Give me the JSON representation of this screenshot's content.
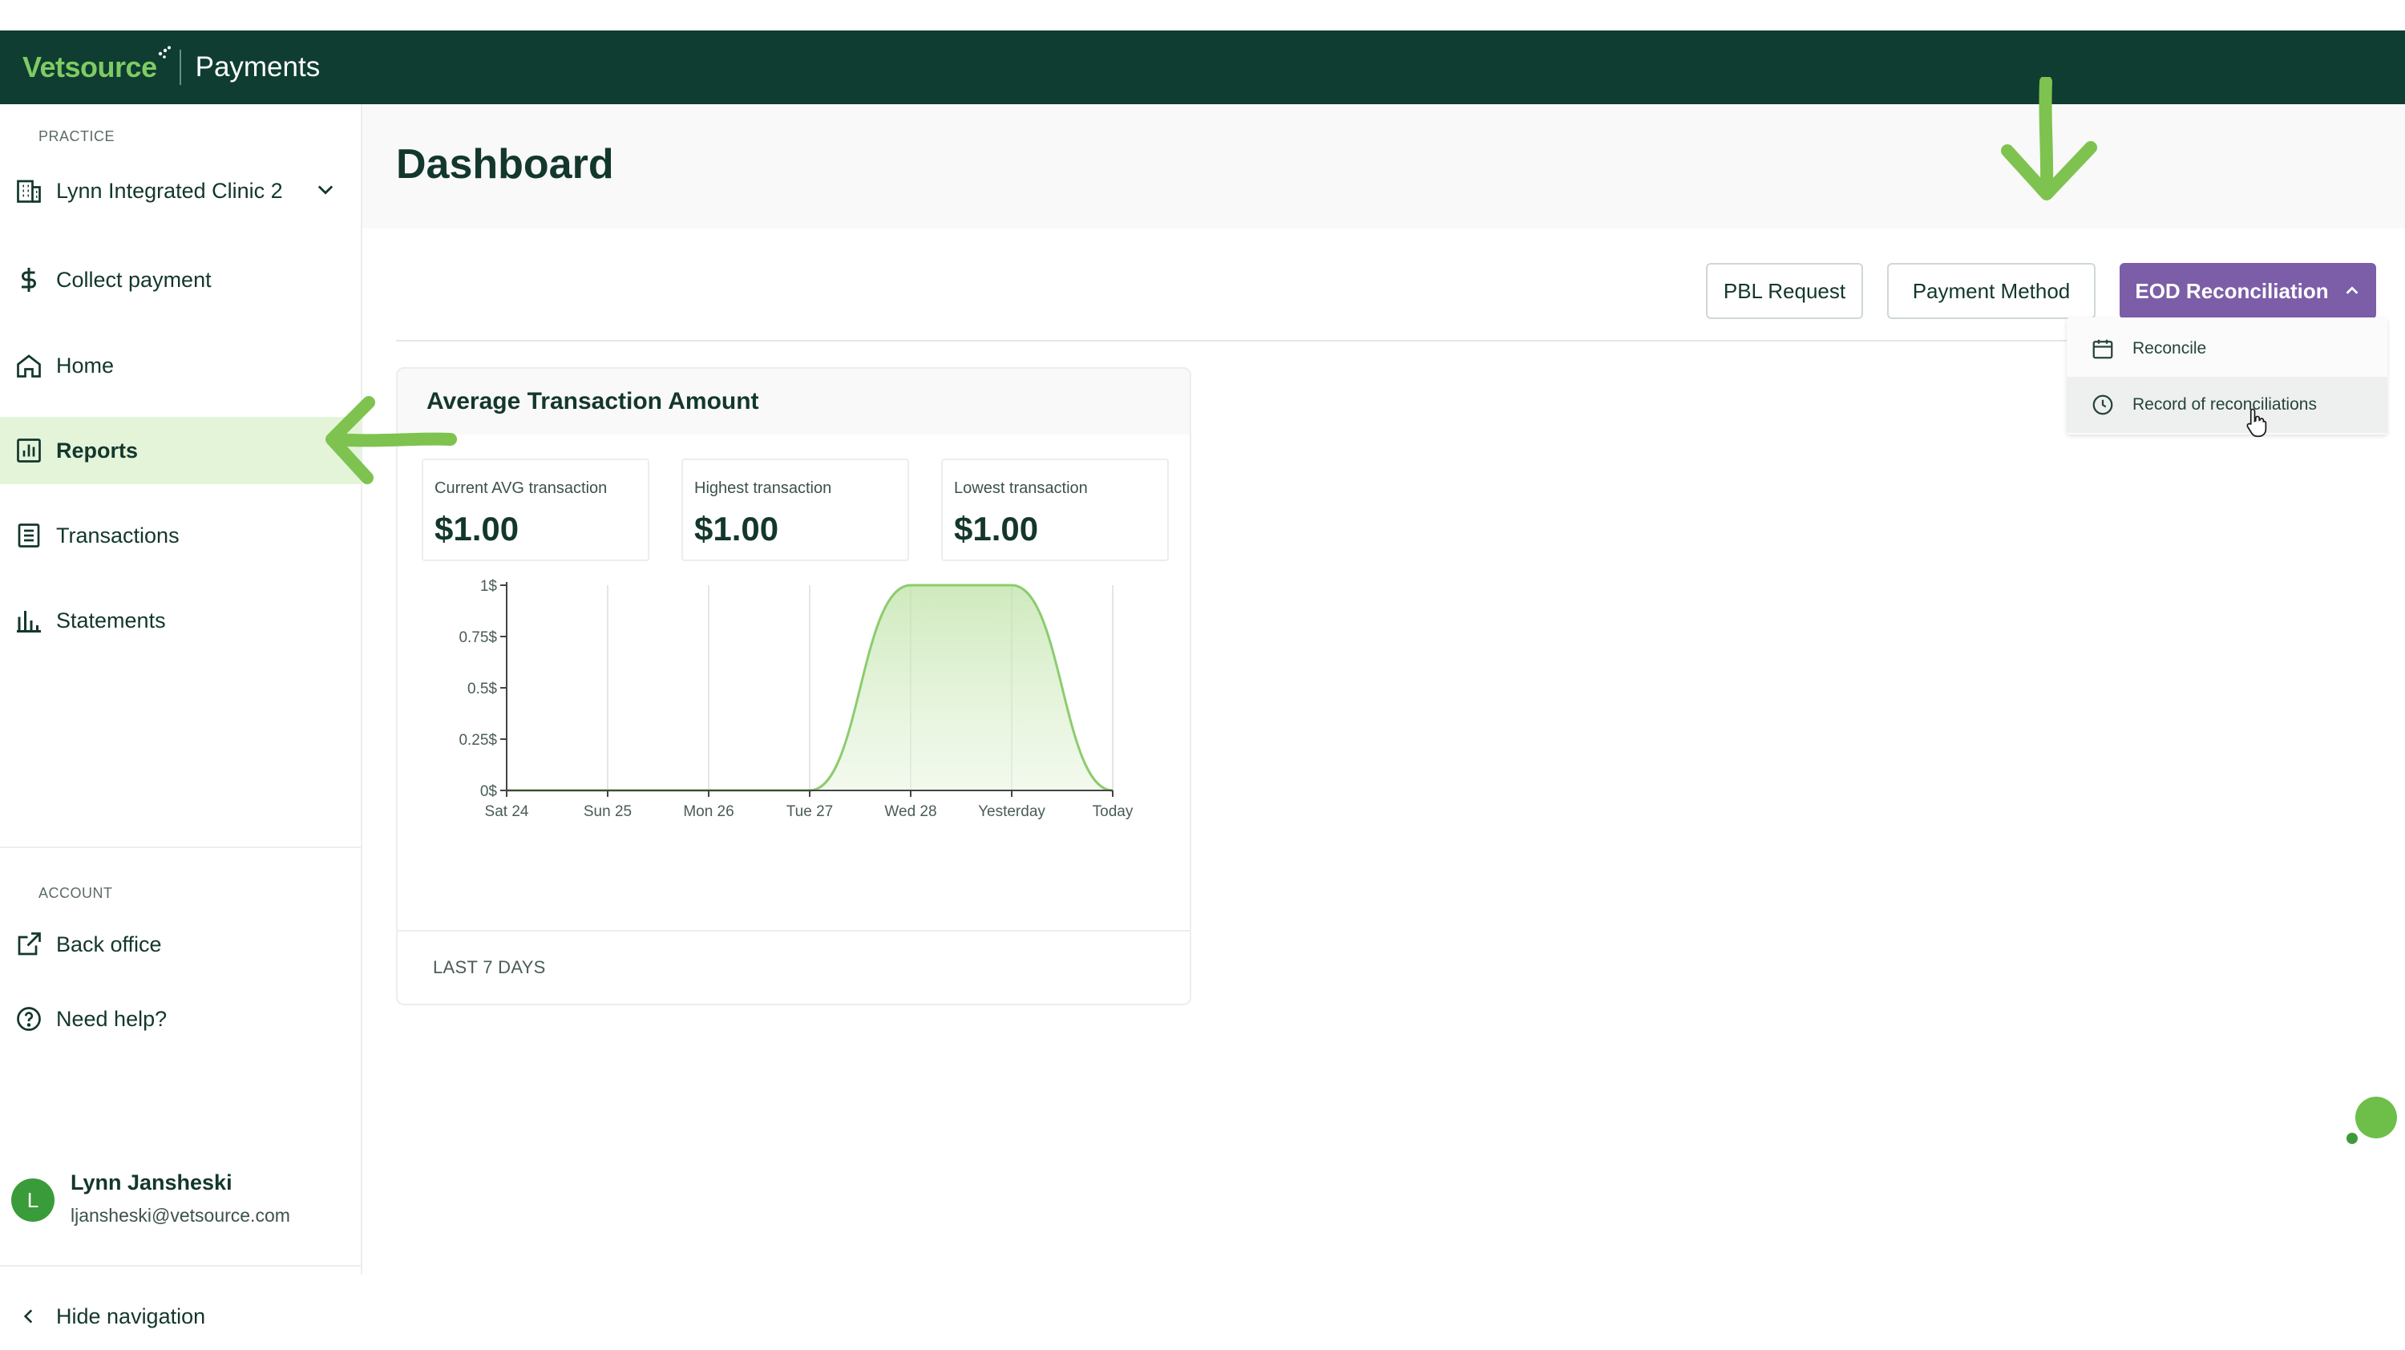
{
  "topbar": {
    "brand": "Vetsource",
    "product": "Payments"
  },
  "sidebar": {
    "practice_label": "PRACTICE",
    "practice_name": "Lynn Integrated Clinic 2",
    "items": [
      {
        "label": "Collect payment",
        "icon": "dollar-icon"
      },
      {
        "label": "Home",
        "icon": "home-icon"
      },
      {
        "label": "Reports",
        "icon": "bar-chart-icon",
        "active": true
      },
      {
        "label": "Transactions",
        "icon": "receipt-icon"
      },
      {
        "label": "Statements",
        "icon": "statements-icon"
      }
    ],
    "account_label": "ACCOUNT",
    "account_items": [
      {
        "label": "Back office",
        "icon": "external-link-icon"
      },
      {
        "label": "Need help?",
        "icon": "help-icon"
      }
    ],
    "user": {
      "initial": "L",
      "name": "Lynn Jansheski",
      "email": "ljansheski@vetsource.com"
    },
    "hide_nav": "Hide navigation"
  },
  "main": {
    "title": "Dashboard",
    "buttons": {
      "pbl_request": "PBL Request",
      "payment_method": "Payment Method",
      "eod_reconciliation": "EOD Reconciliation"
    },
    "dropdown": {
      "items": [
        {
          "label": "Reconcile",
          "icon": "calendar-icon"
        },
        {
          "label": "Record of reconciliations",
          "icon": "clock-icon"
        }
      ]
    }
  },
  "card": {
    "title": "Average Transaction Amount",
    "stats": [
      {
        "label": "Current AVG transaction",
        "value": "$1.00"
      },
      {
        "label": "Highest transaction",
        "value": "$1.00"
      },
      {
        "label": "Lowest transaction",
        "value": "$1.00"
      }
    ],
    "footer": "LAST 7 DAYS"
  },
  "colors": {
    "topbar": "#0f3d31",
    "accent_green": "#7ecb63",
    "active_nav": "#e4f4d9",
    "primary_button": "#7b5ea7"
  },
  "chart_data": {
    "type": "area",
    "categories": [
      "Sat 24",
      "Sun 25",
      "Mon 26",
      "Tue 27",
      "Wed 28",
      "Yesterday",
      "Today"
    ],
    "values": [
      0,
      0,
      0,
      0,
      1,
      1,
      0
    ],
    "y_ticks": [
      "0$",
      "0.25$",
      "0.5$",
      "0.75$",
      "1$"
    ],
    "ylim": [
      0,
      1
    ],
    "grid": "vertical"
  }
}
